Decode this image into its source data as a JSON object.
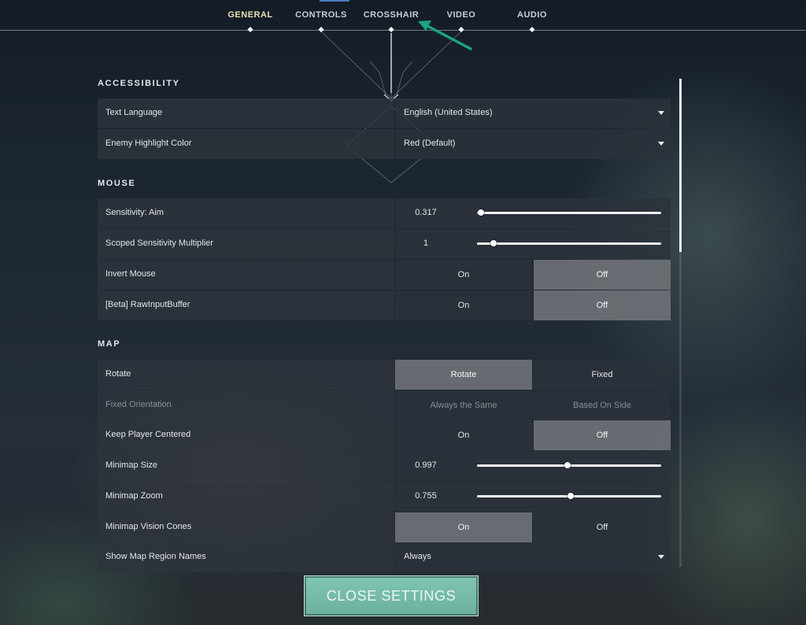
{
  "nav": {
    "tabs": [
      {
        "label": "GENERAL",
        "active": true
      },
      {
        "label": "CONTROLS",
        "active": false
      },
      {
        "label": "CROSSHAIR",
        "active": false
      },
      {
        "label": "VIDEO",
        "active": false
      },
      {
        "label": "AUDIO",
        "active": false
      }
    ]
  },
  "sections": {
    "accessibility": {
      "title": "ACCESSIBILITY",
      "text_language": {
        "label": "Text Language",
        "value": "English (United States)"
      },
      "enemy_highlight": {
        "label": "Enemy Highlight Color",
        "value": "Red (Default)"
      }
    },
    "mouse": {
      "title": "MOUSE",
      "sensitivity": {
        "label": "Sensitivity: Aim",
        "value": "0.317",
        "fill": 0.02
      },
      "scoped": {
        "label": "Scoped Sensitivity Multiplier",
        "value": "1",
        "fill": 0.09
      },
      "invert": {
        "label": "Invert Mouse",
        "on": "On",
        "off": "Off",
        "selected": "off"
      },
      "raw_input": {
        "label": "[Beta] RawInputBuffer",
        "on": "On",
        "off": "Off",
        "selected": "off"
      }
    },
    "map": {
      "title": "MAP",
      "rotate": {
        "label": "Rotate",
        "opt1": "Rotate",
        "opt2": "Fixed",
        "selected": "opt1"
      },
      "fixed_orientation": {
        "label": "Fixed Orientation",
        "opt1": "Always the Same",
        "opt2": "Based On Side",
        "disabled": true
      },
      "keep_centered": {
        "label": "Keep Player Centered",
        "on": "On",
        "off": "Off",
        "selected": "off"
      },
      "minimap_size": {
        "label": "Minimap Size",
        "value": "0.997",
        "fill": 0.49
      },
      "minimap_zoom": {
        "label": "Minimap Zoom",
        "value": "0.755",
        "fill": 0.51
      },
      "vision_cones": {
        "label": "Minimap Vision Cones",
        "on": "On",
        "off": "Off",
        "selected": "on"
      },
      "region_names": {
        "label": "Show Map Region Names",
        "value": "Always"
      }
    }
  },
  "footer": {
    "close_label": "CLOSE SETTINGS"
  },
  "colors": {
    "accent_teal": "#6bb09e",
    "annotation_arrow": "#19a383",
    "active_tab": "#e8e2b4"
  }
}
